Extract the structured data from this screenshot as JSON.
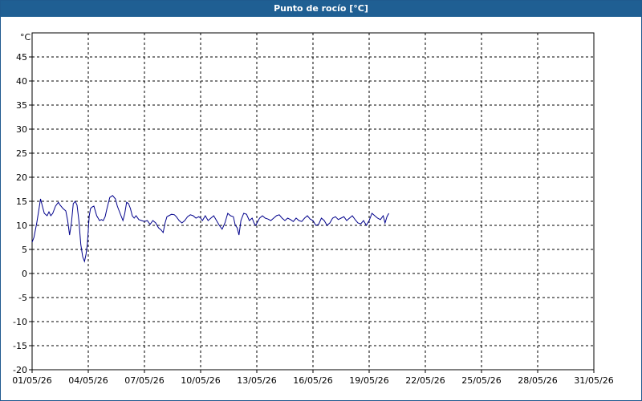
{
  "window": {
    "title": "Punto de rocío [°C]"
  },
  "chart_data": {
    "type": "line",
    "title": "Punto de rocío [°C]",
    "ylabel": "°C",
    "xlabel": "",
    "ylim": [
      -20,
      50
    ],
    "yticks": [
      -20,
      -15,
      -10,
      -5,
      0,
      5,
      10,
      15,
      20,
      25,
      30,
      35,
      40,
      45
    ],
    "xlim": [
      1,
      31
    ],
    "xticks": [
      {
        "day": 1,
        "label": "01/05/26"
      },
      {
        "day": 4,
        "label": "04/05/26"
      },
      {
        "day": 7,
        "label": "07/05/26"
      },
      {
        "day": 10,
        "label": "10/05/26"
      },
      {
        "day": 13,
        "label": "13/05/26"
      },
      {
        "day": 16,
        "label": "16/05/26"
      },
      {
        "day": 19,
        "label": "19/05/26"
      },
      {
        "day": 22,
        "label": "22/05/26"
      },
      {
        "day": 25,
        "label": "25/05/26"
      },
      {
        "day": 28,
        "label": "28/05/26"
      },
      {
        "day": 31,
        "label": "31/05/26"
      }
    ],
    "grid": true,
    "line_color": "#00008b",
    "series": [
      {
        "x": [
          1.0,
          1.1,
          1.25,
          1.35,
          1.45,
          1.55,
          1.65,
          1.8,
          1.9,
          2.0,
          2.1,
          2.25,
          2.4,
          2.5,
          2.65,
          2.8,
          2.9,
          3.0,
          3.1,
          3.2,
          3.3,
          3.4,
          3.5,
          3.6,
          3.7,
          3.8,
          3.88,
          3.95,
          4.0,
          4.05,
          4.12,
          4.2,
          4.3,
          4.45,
          4.6,
          4.7,
          4.8,
          4.9,
          5.0,
          5.15,
          5.3,
          5.45,
          5.55,
          5.65,
          5.75,
          5.85,
          5.95,
          6.05,
          6.15,
          6.25,
          6.35,
          6.45,
          6.55,
          6.7,
          6.85,
          7.0,
          7.15,
          7.3,
          7.45,
          7.6,
          7.75,
          7.9,
          8.0,
          8.1,
          8.2,
          8.3,
          8.45,
          8.6,
          8.7,
          8.85,
          9.0,
          9.15,
          9.3,
          9.45,
          9.6,
          9.75,
          9.9,
          10.0,
          10.1,
          10.25,
          10.4,
          10.55,
          10.7,
          10.85,
          11.0,
          11.15,
          11.3,
          11.45,
          11.6,
          11.75,
          11.85,
          11.95,
          12.05,
          12.15,
          12.3,
          12.45,
          12.6,
          12.75,
          12.85,
          12.95,
          13.05,
          13.15,
          13.3,
          13.45,
          13.6,
          13.75,
          13.9,
          14.05,
          14.2,
          14.35,
          14.5,
          14.65,
          14.8,
          14.95,
          15.1,
          15.25,
          15.4,
          15.55,
          15.7,
          15.85,
          16.0,
          16.15,
          16.3,
          16.45,
          16.6,
          16.75,
          16.9,
          17.05,
          17.2,
          17.35,
          17.5,
          17.65,
          17.8,
          17.95,
          18.1,
          18.25,
          18.4,
          18.55,
          18.7,
          18.85,
          19.0,
          19.15,
          19.3,
          19.45,
          19.6,
          19.75,
          19.85,
          19.95,
          20.05
        ],
        "y": [
          6.5,
          7.5,
          10.5,
          13.0,
          15.5,
          14.0,
          12.5,
          12.0,
          12.8,
          12.0,
          12.5,
          14.0,
          14.8,
          14.2,
          13.5,
          13.0,
          11.0,
          8.0,
          10.5,
          14.5,
          15.0,
          14.2,
          11.0,
          6.0,
          3.5,
          2.5,
          4.0,
          6.0,
          9.0,
          12.0,
          13.5,
          13.8,
          14.0,
          12.0,
          11.0,
          11.2,
          11.0,
          11.8,
          13.5,
          15.8,
          16.2,
          15.5,
          14.0,
          13.0,
          12.0,
          11.0,
          12.5,
          14.8,
          14.5,
          13.5,
          12.0,
          11.5,
          12.0,
          11.2,
          11.0,
          10.8,
          11.0,
          10.2,
          11.0,
          10.5,
          9.5,
          9.0,
          8.5,
          10.5,
          11.8,
          12.0,
          12.3,
          12.2,
          11.8,
          11.0,
          10.5,
          11.0,
          11.8,
          12.2,
          12.0,
          11.5,
          11.8,
          11.5,
          11.0,
          12.0,
          11.0,
          11.5,
          12.0,
          11.0,
          10.0,
          9.2,
          10.5,
          12.5,
          12.0,
          11.8,
          10.0,
          9.5,
          8.0,
          11.0,
          12.5,
          12.3,
          11.0,
          11.5,
          10.5,
          10.0,
          10.8,
          11.5,
          12.0,
          11.5,
          11.3,
          11.0,
          11.5,
          12.0,
          12.2,
          11.5,
          11.0,
          11.5,
          11.2,
          10.8,
          11.5,
          11.0,
          10.8,
          11.5,
          12.0,
          11.3,
          11.0,
          10.0,
          10.2,
          11.5,
          11.0,
          10.0,
          10.5,
          11.5,
          11.8,
          11.2,
          11.5,
          11.8,
          11.0,
          11.5,
          12.0,
          11.2,
          10.5,
          10.3,
          11.0,
          10.0,
          11.0,
          12.5,
          12.0,
          11.5,
          11.2,
          12.0,
          10.5,
          11.8,
          12.5
        ]
      }
    ]
  }
}
